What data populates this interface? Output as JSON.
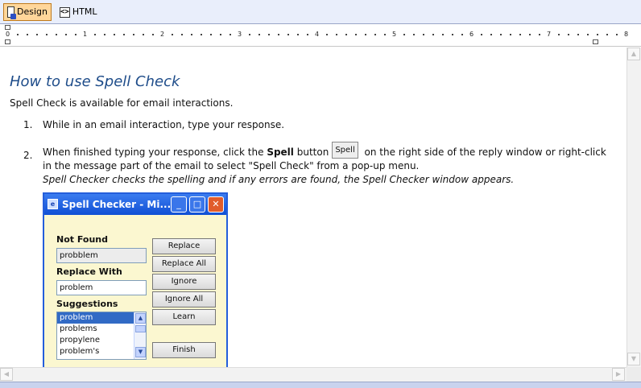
{
  "toolbar": {
    "design_label": "Design",
    "html_label": "HTML",
    "html_icon_text": "<>"
  },
  "ruler": {
    "numbers": [
      "0",
      "1",
      "2",
      "3",
      "4",
      "5",
      "6",
      "7",
      "8"
    ]
  },
  "document": {
    "title": "How to use Spell Check",
    "intro": "Spell Check is available for email interactions.",
    "steps": [
      {
        "num": "1.",
        "text": "While in an email interaction, type your response."
      },
      {
        "num": "2.",
        "text_before": "When finished typing your response, click the ",
        "bold": "Spell",
        "text_mid": " button",
        "button_label": "Spell",
        "text_after": " on the right side of the reply window or right-click",
        "line2": "in the message part of the email to select \"Spell Check\" from a pop-up menu.",
        "note": "Spell Checker checks the spelling and if any errors are found, the Spell Checker window appears."
      }
    ]
  },
  "spell_window": {
    "title": "Spell Checker - Mi...",
    "not_found_label": "Not Found",
    "not_found_value": "probblem",
    "replace_with_label": "Replace With",
    "replace_with_value": "problem",
    "suggestions_label": "Suggestions",
    "suggestions": [
      "problem",
      "problems",
      "propylene",
      "problem's"
    ],
    "selected_suggestion": "problem",
    "buttons": {
      "replace": "Replace",
      "replace_all": "Replace All",
      "ignore": "Ignore",
      "ignore_all": "Ignore All",
      "learn": "Learn",
      "finish": "Finish"
    }
  }
}
